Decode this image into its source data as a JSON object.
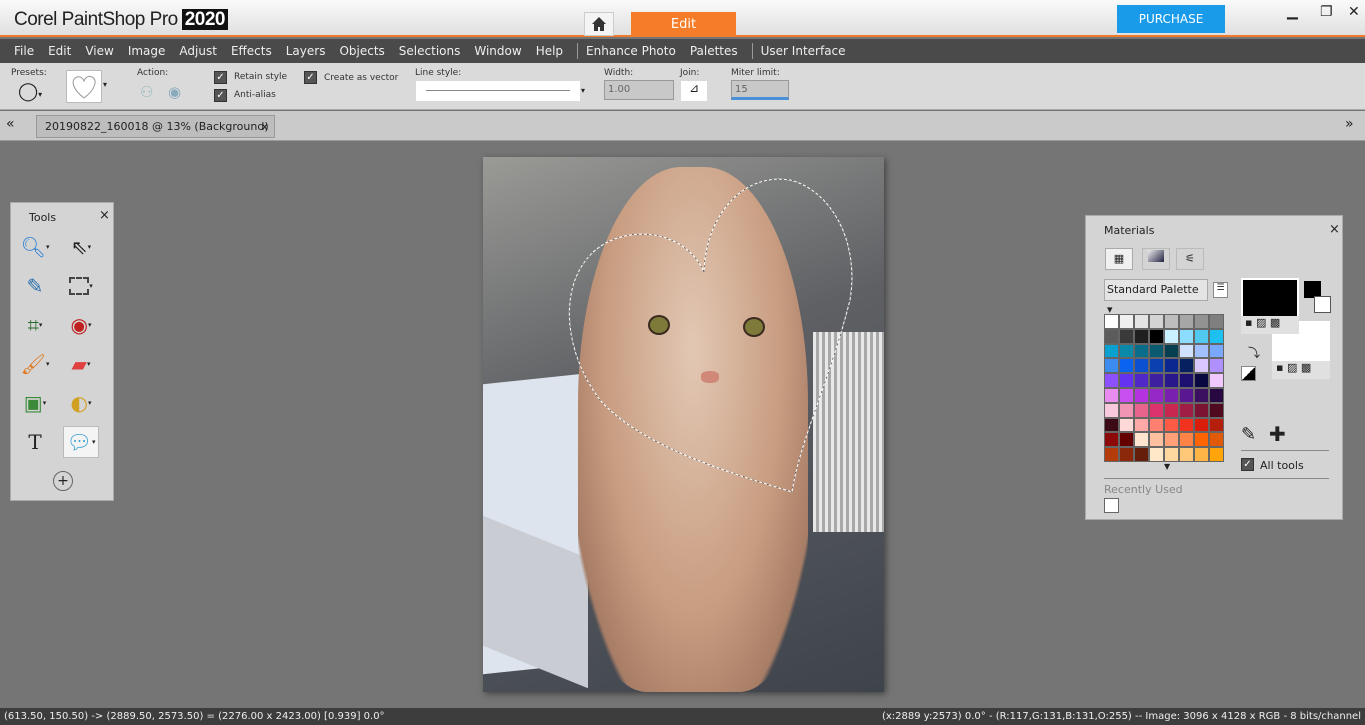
{
  "app": {
    "logo_text": "Corel PaintShop Pro",
    "year": "2020",
    "workspace_tab": "Edit",
    "purchase": "PURCHASE"
  },
  "menu": [
    "File",
    "Edit",
    "View",
    "Image",
    "Adjust",
    "Effects",
    "Layers",
    "Objects",
    "Selections",
    "Window",
    "Help",
    "Enhance Photo",
    "Palettes",
    "User Interface"
  ],
  "toolbar": {
    "presets": "Presets:",
    "action": "Action:",
    "retain_style": "Retain style",
    "anti_alias": "Anti-alias",
    "create_vector": "Create as vector",
    "line_style": "Line style:",
    "width_label": "Width:",
    "width_value": "1.00",
    "join_label": "Join:",
    "miter_label": "Miter limit:",
    "miter_value": "15"
  },
  "document_tab": {
    "label": "20190822_160018 @  13% (Background)",
    "close": "x"
  },
  "tools_panel": {
    "title": "Tools",
    "close": "×",
    "tools": [
      "zoom",
      "pick",
      "dropper",
      "selection",
      "crop",
      "red-eye",
      "paint-brush",
      "eraser",
      "flood-fill",
      "dodge",
      "text",
      "preset-shape"
    ]
  },
  "materials": {
    "title": "Materials",
    "close": "×",
    "palette_select": "Standard Palette",
    "all_tools": "All tools",
    "recently_used": "Recently Used",
    "foreground": "#000000",
    "background": "#ffffff",
    "swatches": [
      "#ffffff",
      "#f0f0f0",
      "#e4e4e4",
      "#d4d4d4",
      "#bdbdbd",
      "#a6a6a6",
      "#929292",
      "#7f7f7f",
      "#5c5c5c",
      "#3a3a3a",
      "#202020",
      "#000000",
      "#c8f0ff",
      "#8cdcff",
      "#50c8f0",
      "#1ec0f0",
      "#0aa0d0",
      "#0a8aa8",
      "#0a6e8a",
      "#0a5a70",
      "#064050",
      "#d0e0ff",
      "#a0c0ff",
      "#78a8ff",
      "#3c8cf0",
      "#0a64f0",
      "#0a50d0",
      "#0a40b0",
      "#0a2890",
      "#062060",
      "#d8c8ff",
      "#b090ff",
      "#8c50ff",
      "#6432f0",
      "#5028c8",
      "#3c20a0",
      "#28188c",
      "#1e1070",
      "#0a0840",
      "#f0c8ff",
      "#e88cf0",
      "#c850f0",
      "#b432e0",
      "#9628c8",
      "#7a20b0",
      "#5a1890",
      "#3c1060",
      "#280840",
      "#f8c8dc",
      "#f096b4",
      "#e8648c",
      "#dc326e",
      "#c82850",
      "#a01e46",
      "#7a1432",
      "#500a20",
      "#3c0a14",
      "#ffd8d8",
      "#ffa8a8",
      "#ff8070",
      "#ff5a46",
      "#f0321e",
      "#d81e0a",
      "#b41e0a",
      "#8c0a0a",
      "#640000",
      "#ffe4d0",
      "#ffc0a0",
      "#ffa078",
      "#ff8246",
      "#ff6400",
      "#e05a0a",
      "#b43c0a",
      "#8c280a",
      "#641e0a",
      "#ffe8c8",
      "#ffd8a0",
      "#ffc878",
      "#ffb446",
      "#ffa50a"
    ]
  },
  "status": {
    "left": "(613.50, 150.50) -> (2889.50, 2573.50) = (2276.00 x 2423.00) [0.939]  0.0°",
    "right": "(x:2889 y:2573) 0.0° - (R:117,G:131,B:131,O:255) -- Image:  3096 x 4128 x RGB - 8 bits/channel"
  },
  "colors": {
    "accent": "#f57c28",
    "purchase": "#1a9bea",
    "menubar": "#4a4a4a",
    "workspace": "#757575"
  }
}
